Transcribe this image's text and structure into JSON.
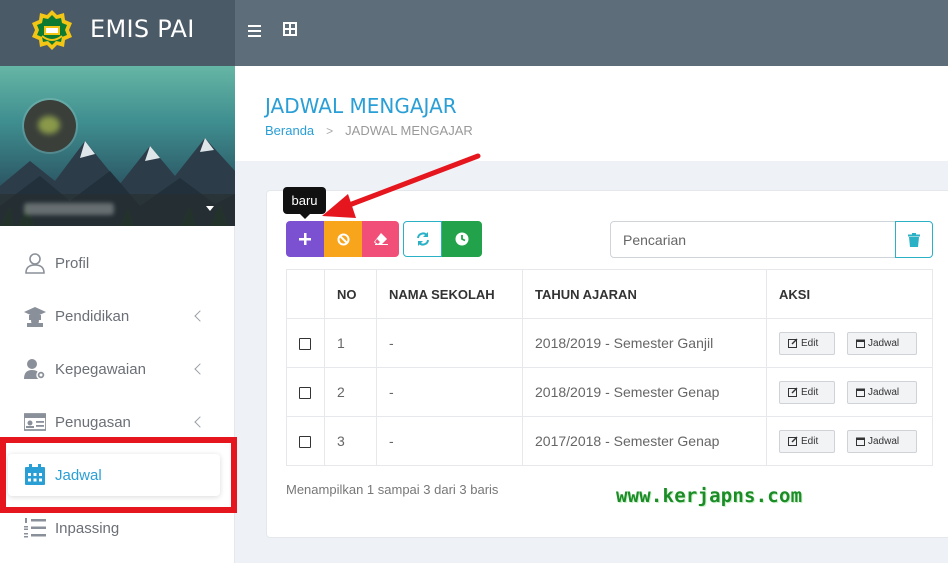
{
  "app": {
    "title": "EMIS PAI",
    "logo": "ministry-emblem"
  },
  "topbar": {
    "menu_icon": "hamburger-icon",
    "apps_icon": "grid-icon"
  },
  "sidebar": {
    "items": [
      {
        "label": "Profil",
        "icon": "user-icon",
        "has_submenu": false
      },
      {
        "label": "Pendidikan",
        "icon": "graduation-icon",
        "has_submenu": true
      },
      {
        "label": "Kepegawaian",
        "icon": "user-gear-icon",
        "has_submenu": true
      },
      {
        "label": "Penugasan",
        "icon": "id-card-icon",
        "has_submenu": true
      },
      {
        "label": "Jadwal",
        "icon": "calendar-icon",
        "active": true
      },
      {
        "label": "Inpassing",
        "icon": "numbered-list-icon",
        "has_submenu": false
      }
    ]
  },
  "page": {
    "title": "JADWAL MENGAJAR",
    "breadcrumb": {
      "home": "Beranda",
      "current": "JADWAL MENGAJAR"
    }
  },
  "toolbar": {
    "tooltip": "baru",
    "search_placeholder": "Pencarian"
  },
  "table": {
    "headers": [
      "NO",
      "NAMA SEKOLAH",
      "TAHUN AJARAN",
      "AKSI"
    ],
    "rows": [
      {
        "no": "1",
        "nama": "-",
        "tahun": "2018/2019 - Semester Ganjil"
      },
      {
        "no": "2",
        "nama": "-",
        "tahun": "2018/2019 - Semester Genap"
      },
      {
        "no": "3",
        "nama": "-",
        "tahun": "2017/2018 - Semester Genap"
      }
    ],
    "edit_label": "Edit",
    "jadwal_label": "Jadwal"
  },
  "footer": {
    "summary": "Menampilkan 1 sampai 3 dari 3 baris"
  },
  "watermark": "www.kerjapns.com",
  "colors": {
    "accent": "#2a9fd6",
    "highlight": "#e5161d",
    "add": "#7b50d1",
    "ban": "#f8a51c",
    "erase": "#f14f78",
    "clock": "#22a24a"
  }
}
